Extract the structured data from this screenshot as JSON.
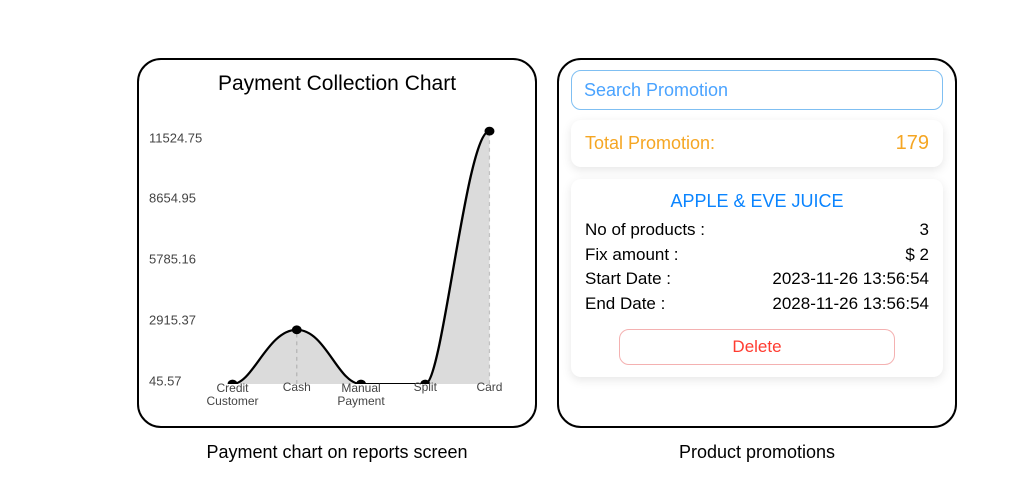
{
  "chart": {
    "title": "Payment Collection Chart",
    "y_ticks": [
      "11524.75",
      "8654.95",
      "5785.16",
      "2915.37",
      "45.57"
    ],
    "x_ticks": [
      "Credit Customer",
      "Cash",
      "Manual Payment",
      "Split",
      "Card"
    ]
  },
  "captions": {
    "left": "Payment chart on reports screen",
    "right": "Product promotions"
  },
  "promotions": {
    "search_placeholder": "Search Promotion",
    "total_label": "Total Promotion:",
    "total_value": "179",
    "item": {
      "title": "APPLE & EVE JUICE",
      "no_of_products_label": "No of products :",
      "no_of_products_value": "3",
      "fix_amount_label": "Fix amount :",
      "fix_amount_value": "$ 2",
      "start_date_label": "Start Date :",
      "start_date_value": "2023-11-26 13:56:54",
      "end_date_label": "End Date :",
      "end_date_value": "2028-11-26 13:56:54"
    },
    "delete_label": "Delete"
  },
  "chart_data": {
    "type": "line",
    "title": "Payment Collection Chart",
    "xlabel": "",
    "ylabel": "",
    "categories": [
      "Credit Customer",
      "Cash",
      "Manual Payment",
      "Split",
      "Card"
    ],
    "values": [
      45.57,
      2500,
      45.57,
      45.57,
      11524.75
    ],
    "ylim": [
      45.57,
      11524.75
    ],
    "area_fill": true,
    "markers": true
  }
}
